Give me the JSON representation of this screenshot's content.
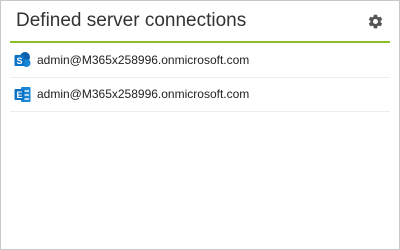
{
  "panel": {
    "title": "Defined server connections",
    "settings_icon": "gear-icon"
  },
  "connections": [
    {
      "icon": "sharepoint-icon",
      "label": "admin@M365x258996.onmicrosoft.com"
    },
    {
      "icon": "exchange-icon",
      "label": "admin@M365x258996.onmicrosoft.com"
    }
  ],
  "colors": {
    "accent": "#8cbd2b",
    "sharepoint": "#0a72c5",
    "exchange": "#0a72c5"
  }
}
